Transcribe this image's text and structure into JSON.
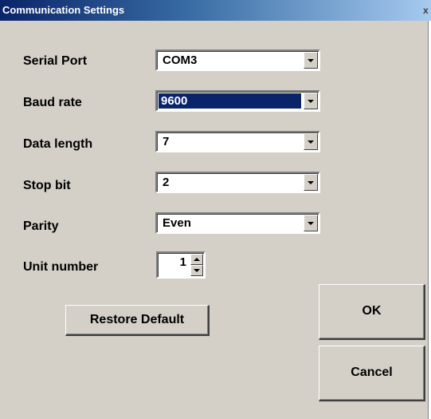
{
  "window": {
    "title": "Communication Settings",
    "close_glyph": "x"
  },
  "fields": {
    "serial_port": {
      "label": "Serial Port",
      "value": "COM3"
    },
    "baud_rate": {
      "label": "Baud rate",
      "value": "9600"
    },
    "data_length": {
      "label": "Data length",
      "value": "7"
    },
    "stop_bit": {
      "label": "Stop bit",
      "value": "2"
    },
    "parity": {
      "label": "Parity",
      "value": "Even"
    },
    "unit_number": {
      "label": "Unit number",
      "value": "1"
    }
  },
  "buttons": {
    "restore_default": "Restore Default",
    "ok": "OK",
    "cancel": "Cancel"
  }
}
